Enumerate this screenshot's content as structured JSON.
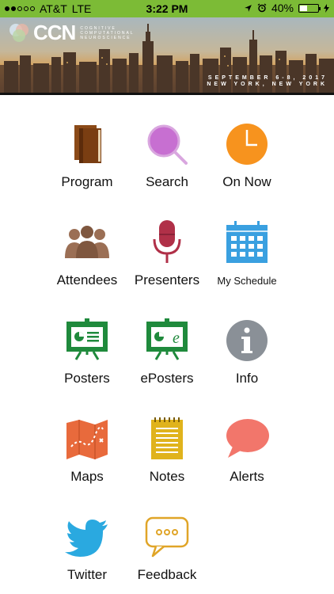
{
  "status_bar": {
    "carrier": "AT&T",
    "network": "LTE",
    "time": "3:22 PM",
    "battery": "40%",
    "battery_level": 0.4
  },
  "banner": {
    "logo": "CCN",
    "logo_subtitle_1": "COGNITIVE",
    "logo_subtitle_2": "COMPUTATIONAL",
    "logo_subtitle_3": "NEUROSCIENCE",
    "date_line": "SEPTEMBER 6-8, 2017",
    "location_line": "NEW YORK, NEW YORK"
  },
  "tiles": [
    {
      "label": "Program",
      "icon": "book-icon"
    },
    {
      "label": "Search",
      "icon": "search-icon"
    },
    {
      "label": "On Now",
      "icon": "clock-icon"
    },
    {
      "label": "Attendees",
      "icon": "people-icon"
    },
    {
      "label": "Presenters",
      "icon": "microphone-icon"
    },
    {
      "label": "My Schedule",
      "icon": "calendar-icon"
    },
    {
      "label": "Posters",
      "icon": "poster-board-icon"
    },
    {
      "label": "ePosters",
      "icon": "eposter-board-icon"
    },
    {
      "label": "Info",
      "icon": "info-icon"
    },
    {
      "label": "Maps",
      "icon": "map-icon"
    },
    {
      "label": "Notes",
      "icon": "notepad-icon"
    },
    {
      "label": "Alerts",
      "icon": "speech-bubble-icon"
    },
    {
      "label": "Twitter",
      "icon": "twitter-bird-icon"
    },
    {
      "label": "Feedback",
      "icon": "feedback-bubble-icon"
    }
  ],
  "colors": {
    "status_bar": "#7cbb36",
    "book": "#7a3e12",
    "search": "#c76fd1",
    "clock": "#f7931e",
    "people": "#9b6f55",
    "microphone": "#b03048",
    "calendar": "#3aa0e0",
    "poster": "#1f8a3c",
    "info": "#8a9097",
    "map": "#e86a3c",
    "notes": "#e0b31c",
    "alerts": "#f2766b",
    "twitter": "#2aa9e0",
    "feedback": "#e0a528"
  }
}
